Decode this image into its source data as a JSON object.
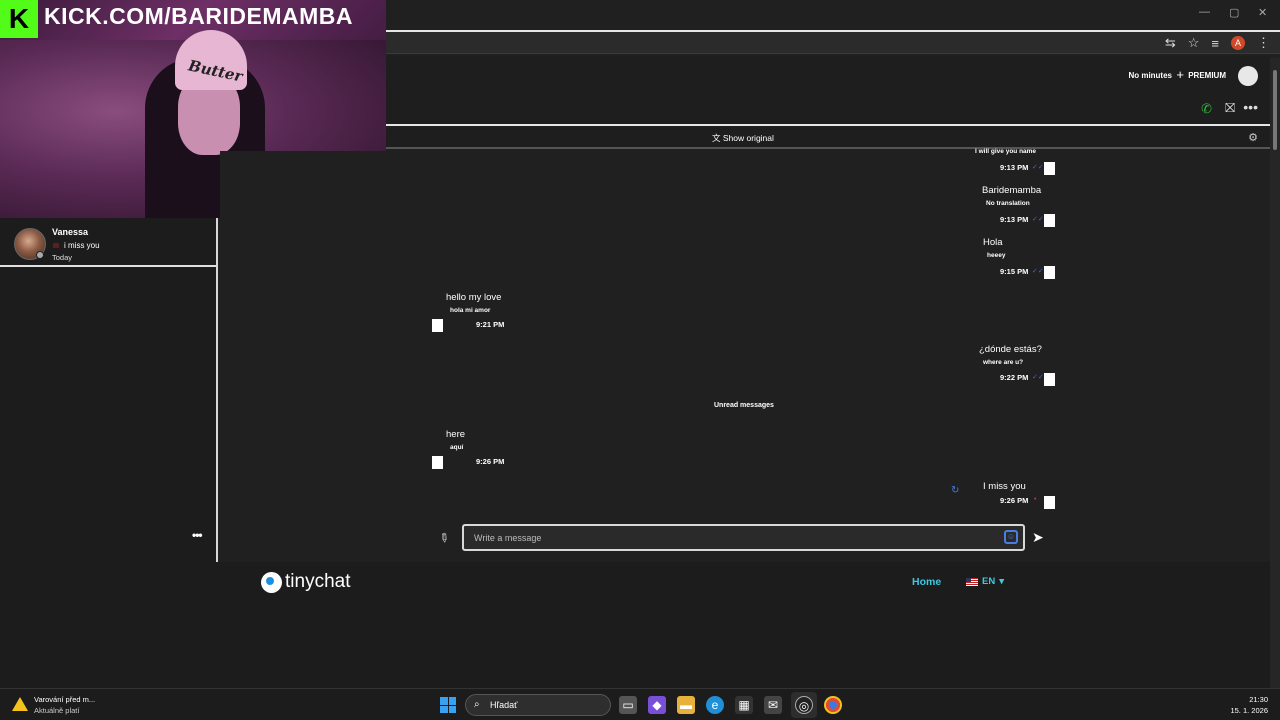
{
  "stream_overlay": {
    "kick_logo": "K",
    "url": "KICK.COM/BARIDEMAMBA",
    "hat_text": "Butter"
  },
  "window": {
    "minimize": "—",
    "maximize": "▢",
    "close": "✕"
  },
  "browser": {
    "icons": [
      "translate-icon",
      "star-icon",
      "media-icon",
      "profile-icon",
      "menu-icon"
    ],
    "profile_initial": "A"
  },
  "header": {
    "minutes_label": "No minutes",
    "add_label": "+",
    "premium_label": "PREMIUM"
  },
  "translation_bar": {
    "show_original": "Show original"
  },
  "sidebar": {
    "contact": {
      "name": "Vanessa",
      "last_message": "i miss you",
      "time": "Today"
    },
    "more_label": "•••"
  },
  "chat": {
    "partial_top": "I will give you name",
    "messages": [
      {
        "dir": "out",
        "text": "",
        "translation": "",
        "time": "9:13 PM",
        "status": "read"
      },
      {
        "dir": "out",
        "text": "Baridemamba",
        "translation": "No translation",
        "time": "9:13 PM",
        "status": "read"
      },
      {
        "dir": "out",
        "text": "Hola",
        "translation": "heeey",
        "time": "9:15 PM",
        "status": "read"
      },
      {
        "dir": "in",
        "text": "hello my love",
        "translation": "hola mi amor",
        "time": "9:21 PM"
      },
      {
        "dir": "out",
        "text": "¿dónde estás?",
        "translation": "where are u?",
        "time": "9:22 PM",
        "status": "read"
      },
      {
        "dir": "in",
        "text": "here",
        "translation": "aquí",
        "time": "9:26 PM"
      },
      {
        "dir": "out",
        "text": "I miss you",
        "translation": "",
        "time": "9:26 PM",
        "status": "failed"
      }
    ],
    "unread_label": "Unread messages"
  },
  "composer": {
    "placeholder": "Write a message"
  },
  "footer": {
    "brand": "tinychat",
    "home_label": "Home",
    "language": "EN"
  },
  "taskbar": {
    "warning_title": "Varování před m...",
    "warning_sub": "Aktuálně platí",
    "search_placeholder": "Hľadať",
    "time": "21:30",
    "date": "15. 1. 2026"
  },
  "colors": {
    "accent_cyan": "#3fc8e0",
    "kick_green": "#53fc18",
    "read_check": "#3a6cc8",
    "failed_check": "#c83a3a"
  }
}
